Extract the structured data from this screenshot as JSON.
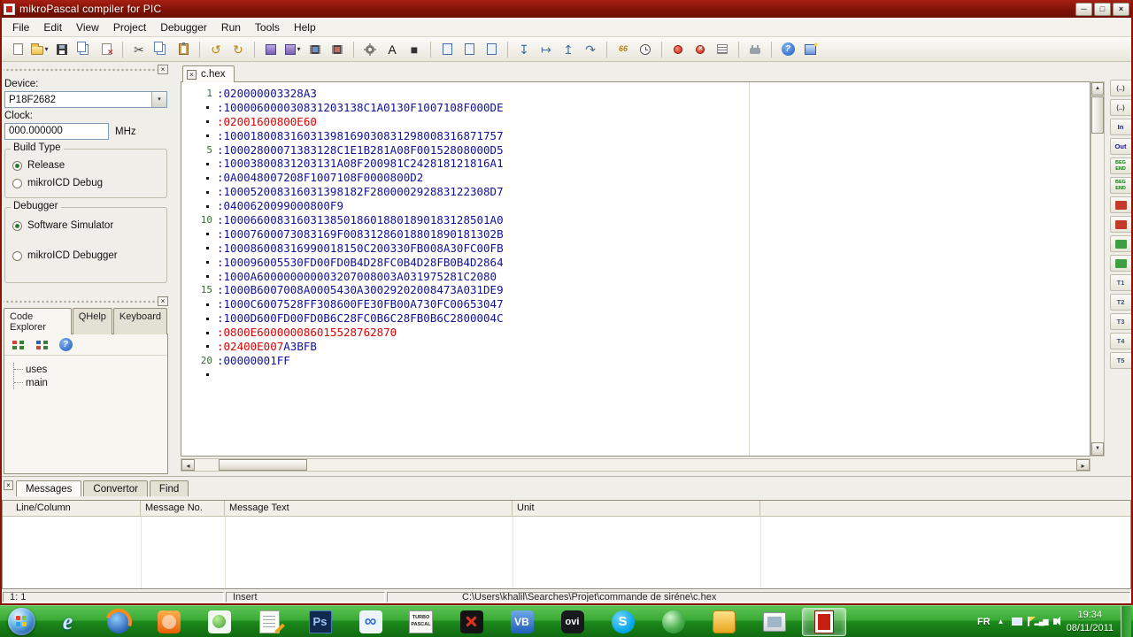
{
  "window": {
    "title": "mikroPascal compiler for PIC",
    "buttons": [
      {
        "name": "minimize-button",
        "glyph": "─"
      },
      {
        "name": "maximize-button",
        "glyph": "□"
      },
      {
        "name": "close-button",
        "glyph": "×"
      }
    ]
  },
  "ui": {
    "close": "×",
    "caret_down": "▾",
    "arrow_up": "▲",
    "arrow_down": "▼",
    "arrow_left": "◂",
    "arrow_right": "▸"
  },
  "menu": {
    "items": [
      "File",
      "Edit",
      "View",
      "Project",
      "Debugger",
      "Run",
      "Tools",
      "Help"
    ]
  },
  "toolbar": {
    "buttons": [
      {
        "name": "new-file-button",
        "icon": "page"
      },
      {
        "name": "open-file-button",
        "icon": "folder",
        "caret": true
      },
      {
        "name": "save-file-button",
        "icon": "floppy"
      },
      {
        "name": "save-all-button",
        "icon": "pages"
      },
      {
        "name": "close-file-button",
        "icon": "pagex"
      },
      {
        "type": "sep"
      },
      {
        "name": "cut-button",
        "glyph": "✂",
        "color": "#4a4a4a"
      },
      {
        "name": "copy-button",
        "icon": "pages"
      },
      {
        "name": "paste-button",
        "icon": "clipboard"
      },
      {
        "type": "sep"
      },
      {
        "name": "undo-button",
        "glyph": "↺",
        "color": "#b8860b"
      },
      {
        "name": "redo-button",
        "glyph": "↻",
        "color": "#b8860b"
      },
      {
        "type": "sep"
      },
      {
        "name": "build-button",
        "icon": "build"
      },
      {
        "name": "build-all-button",
        "icon": "build",
        "caret": true
      },
      {
        "name": "build-and-program-button",
        "icon": "chip"
      },
      {
        "name": "program-button",
        "icon": "chip2"
      },
      {
        "type": "sep"
      },
      {
        "name": "options-button",
        "icon": "gear"
      },
      {
        "name": "font-button",
        "glyph": "A",
        "color": "#111"
      },
      {
        "name": "window-layout-button",
        "glyph": "■",
        "color": "#333"
      },
      {
        "type": "sep"
      },
      {
        "name": "print-preview-button",
        "icon": "pageb"
      },
      {
        "name": "print-button",
        "icon": "pageb"
      },
      {
        "name": "export-button",
        "icon": "pageb"
      },
      {
        "type": "sep"
      },
      {
        "name": "step-into-button",
        "glyph": "↧",
        "color": "#3a6ea5"
      },
      {
        "name": "step-over-button",
        "glyph": "↦",
        "color": "#3a6ea5"
      },
      {
        "name": "step-out-button",
        "glyph": "↥",
        "color": "#3a6ea5"
      },
      {
        "name": "run-to-cursor-button",
        "glyph": "↷",
        "color": "#3a6ea5"
      },
      {
        "type": "sep"
      },
      {
        "name": "watch-values-button",
        "glyph": "66",
        "color": "#b8860b",
        "small": true
      },
      {
        "name": "stopwatch-button",
        "icon": "clock"
      },
      {
        "type": "sep"
      },
      {
        "name": "toggle-breakpoint-button",
        "icon": "reddot"
      },
      {
        "name": "clear-breakpoints-button",
        "icon": "redx"
      },
      {
        "name": "breakpoints-list-button",
        "icon": "list"
      },
      {
        "type": "sep"
      },
      {
        "name": "usart-terminal-button",
        "icon": "plug"
      },
      {
        "type": "sep"
      },
      {
        "name": "help-button",
        "icon": "help"
      },
      {
        "name": "project-wizard-button",
        "icon": "wizard"
      }
    ]
  },
  "sidebar": {
    "device_label": "Device:",
    "device_value": "P18F2682",
    "clock_label": "Clock:",
    "clock_value": "000.000000",
    "clock_unit": "MHz",
    "build_type": {
      "title": "Build Type",
      "options": [
        {
          "label": "Release",
          "selected": true
        },
        {
          "label": "mikroICD Debug",
          "selected": false
        }
      ]
    },
    "debugger": {
      "title": "Debugger",
      "options": [
        {
          "label": "Software Simulator",
          "selected": true
        },
        {
          "label": "mikroICD Debugger",
          "selected": false
        }
      ]
    },
    "explorer_tabs": [
      {
        "label": "Code Explorer",
        "active": true
      },
      {
        "label": "QHelp",
        "active": false
      },
      {
        "label": "Keyboard",
        "active": false
      }
    ],
    "explorer_toolbar": [
      {
        "name": "explorer-expand-button",
        "icon": "nodes1"
      },
      {
        "name": "explorer-collapse-button",
        "icon": "nodes2"
      },
      {
        "name": "explorer-help-button",
        "icon": "help"
      }
    ],
    "tree_items": [
      "uses",
      "main"
    ]
  },
  "editor": {
    "tab_label": "c.hex",
    "lines": [
      {
        "gutter": "1",
        "segments": [
          {
            "text": ":020000003328A3",
            "color": "blue"
          }
        ]
      },
      {
        "gutter": "•",
        "segments": [
          {
            "text": ":100006000030831203138C1A0130F1007108F000DE",
            "color": "blue"
          }
        ]
      },
      {
        "gutter": "•",
        "segments": [
          {
            "text": ":02001600800E60",
            "color": "red"
          }
        ]
      },
      {
        "gutter": "•",
        "segments": [
          {
            "text": ":100018008316031398169030831298008316871757",
            "color": "blue"
          }
        ]
      },
      {
        "gutter": "5",
        "segments": [
          {
            "text": ":10002800071383128C1E1B281A08F00152808000D5",
            "color": "blue"
          }
        ]
      },
      {
        "gutter": "•",
        "segments": [
          {
            "text": ":10003800831203131A08F200981C242818121816A1",
            "color": "blue"
          }
        ]
      },
      {
        "gutter": "•",
        "segments": [
          {
            "text": ":0A0048007208F1007108F0000800D2",
            "color": "blue"
          }
        ]
      },
      {
        "gutter": "•",
        "segments": [
          {
            "text": ":100052008316031398182F280000292883122308D7",
            "color": "blue"
          }
        ]
      },
      {
        "gutter": "•",
        "segments": [
          {
            "text": ":0400620099000800F9",
            "color": "blue"
          }
        ]
      },
      {
        "gutter": "10",
        "segments": [
          {
            "text": ":1000660083160313850186018801890183128501A0",
            "color": "blue"
          }
        ]
      },
      {
        "gutter": "•",
        "segments": [
          {
            "text": ":10007600073083169F00831286018801890181302B",
            "color": "blue"
          }
        ]
      },
      {
        "gutter": "•",
        "segments": [
          {
            "text": ":100086008316990018150C200330FB008A30FC00FB",
            "color": "blue"
          }
        ]
      },
      {
        "gutter": "•",
        "segments": [
          {
            "text": ":100096005530FD00FD0B4D28FC0B4D28FB0B4D2864",
            "color": "blue"
          }
        ]
      },
      {
        "gutter": "•",
        "segments": [
          {
            "text": ":1000A600000000003207008003A031975281C2080",
            "color": "blue"
          }
        ]
      },
      {
        "gutter": "15",
        "segments": [
          {
            "text": ":1000B6007008A0005430A30029202008473A031DE9",
            "color": "blue"
          }
        ]
      },
      {
        "gutter": "•",
        "segments": [
          {
            "text": ":1000C6007528FF308600FE30FB00A730FC00653047",
            "color": "blue"
          }
        ]
      },
      {
        "gutter": "•",
        "segments": [
          {
            "text": ":1000D600FD00FD0B6C28FC0B6C28FB0B6C2800004C",
            "color": "blue"
          }
        ]
      },
      {
        "gutter": "•",
        "segments": [
          {
            "text": ":0800E600000086015528762870",
            "color": "red"
          }
        ]
      },
      {
        "gutter": "•",
        "segments": [
          {
            "text": ":02400E007",
            "color": "red"
          },
          {
            "text": "A3BFB",
            "color": "blue"
          }
        ]
      },
      {
        "gutter": "20",
        "segments": [
          {
            "text": ":00000001FF",
            "color": "blue"
          }
        ]
      },
      {
        "gutter": "•",
        "segments": []
      }
    ]
  },
  "right_strip": {
    "items": [
      {
        "name": "snippet-comment-1",
        "label": "(..)",
        "color": "#4a4a4a"
      },
      {
        "name": "snippet-comment-2",
        "label": "(..)",
        "color": "#4a4a4a"
      },
      {
        "name": "snippet-in",
        "label": "In",
        "color": "#16169a"
      },
      {
        "name": "snippet-out",
        "label": "Out",
        "color": "#16169a"
      },
      {
        "name": "snippet-begin-end-1",
        "label": "BEG END",
        "color": "#0b7a0b",
        "tiny": true
      },
      {
        "name": "snippet-begin-end-2",
        "label": "BEG END",
        "color": "#0b7a0b",
        "tiny": true
      },
      {
        "name": "snippet-red-1",
        "swatch": "#c43a2a"
      },
      {
        "name": "snippet-red-2",
        "swatch": "#c43a2a"
      },
      {
        "name": "snippet-green-1",
        "swatch": "#3f9e3f"
      },
      {
        "name": "snippet-green-2",
        "swatch": "#3f9e3f"
      },
      {
        "name": "snippet-t1",
        "label": "T1",
        "color": "#3f567a"
      },
      {
        "name": "snippet-t2",
        "label": "T2",
        "color": "#3f567a"
      },
      {
        "name": "snippet-t3",
        "label": "T3",
        "color": "#3f567a"
      },
      {
        "name": "snippet-t4",
        "label": "T4",
        "color": "#3f567a"
      },
      {
        "name": "snippet-t5",
        "label": "T5",
        "color": "#3f567a"
      }
    ]
  },
  "messages": {
    "tabs": [
      {
        "label": "Messages",
        "active": true
      },
      {
        "label": "Convertor",
        "active": false
      },
      {
        "label": "Find",
        "active": false
      }
    ],
    "columns": [
      "Line/Column",
      "Message No.",
      "Message Text",
      "Unit"
    ]
  },
  "statusbar": {
    "cursor": "1: 1",
    "mode": "Insert",
    "file_path": "C:\\Users\\khalil\\Searches\\Projet\\commande de siréne\\c.hex"
  },
  "taskbar": {
    "icons": [
      {
        "name": "taskbar-internet-explorer",
        "kind": "ie",
        "label": "e"
      },
      {
        "name": "taskbar-firefox",
        "kind": "fx"
      },
      {
        "name": "taskbar-media-player",
        "kind": "wmp"
      },
      {
        "name": "taskbar-green-player",
        "kind": "jgreen"
      },
      {
        "name": "taskbar-text-editor",
        "kind": "note"
      },
      {
        "name": "taskbar-photoshop",
        "kind": "ps",
        "label": "Ps"
      },
      {
        "name": "taskbar-blue-swirl-app",
        "kind": "inf",
        "label": "∞"
      },
      {
        "name": "taskbar-turbo-pascal",
        "kind": "turbo",
        "label": "TURBO PASCAL"
      },
      {
        "name": "taskbar-disc-burner",
        "kind": "burn"
      },
      {
        "name": "taskbar-visual-basic",
        "kind": "vb",
        "label": "VB"
      },
      {
        "name": "taskbar-ovi-suite",
        "kind": "ovi",
        "label": "ovi"
      },
      {
        "name": "taskbar-skype",
        "kind": "skype",
        "label": "S"
      },
      {
        "name": "taskbar-green-globe-app",
        "kind": "globe"
      },
      {
        "name": "taskbar-gold-app",
        "kind": "gold"
      },
      {
        "name": "taskbar-capture-tool",
        "kind": "cap"
      },
      {
        "name": "taskbar-mikropascal",
        "kind": "mp",
        "active": true
      }
    ],
    "tray_icons": [
      {
        "name": "tray-display-icon",
        "kind": "disp"
      },
      {
        "name": "tray-flag-icon",
        "kind": "flag"
      },
      {
        "name": "tray-network-icon",
        "kind": "net",
        "glyph": "▂▄▆"
      },
      {
        "name": "tray-volume-icon",
        "kind": "spk"
      }
    ],
    "tray": {
      "language": "FR",
      "chevron": "▲",
      "time": "19:34",
      "date": "08/11/2011"
    }
  }
}
